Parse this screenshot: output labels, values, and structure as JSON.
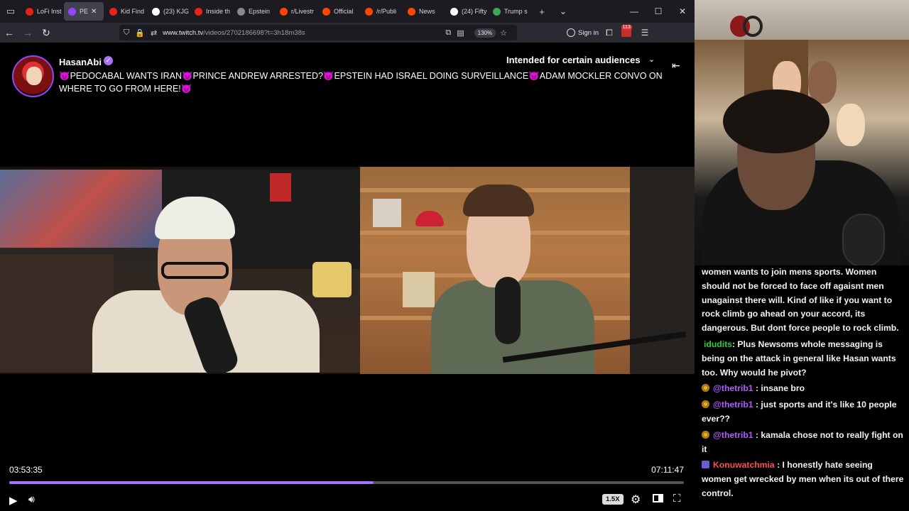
{
  "browser": {
    "tabs": [
      {
        "label": "LoFi Inst",
        "color": "#e62117",
        "active": false
      },
      {
        "label": "PE",
        "color": "#9147ff",
        "active": true
      },
      {
        "label": "Kid Find",
        "color": "#e62117",
        "active": false
      },
      {
        "label": "(23) KJG",
        "color": "#ffffff",
        "active": false
      },
      {
        "label": "Inside th",
        "color": "#e62117",
        "active": false
      },
      {
        "label": "Epstein",
        "color": "#888888",
        "active": false
      },
      {
        "label": "r/Livestr",
        "color": "#ff4500",
        "active": false
      },
      {
        "label": "Official",
        "color": "#ff4500",
        "active": false
      },
      {
        "label": "/r/Publi",
        "color": "#ff4500",
        "active": false
      },
      {
        "label": "News",
        "color": "#ff4500",
        "active": false
      },
      {
        "label": "(24) Fifty",
        "color": "#ffffff",
        "active": false
      },
      {
        "label": "Trump s",
        "color": "#3aa757",
        "active": false
      }
    ],
    "url_host": "www.twitch.tv",
    "url_path": "/videos/2702186698?t=3h18m38s",
    "zoom": "130%",
    "sign_in": "Sign in",
    "notification_count": "113"
  },
  "stream": {
    "channel": "HasanAbi",
    "title": "😈PEDOCABAL WANTS IRAN😈PRINCE ANDREW ARRESTED?😈EPSTEIN HAD ISRAEL DOING SURVEILLANCE😈ADAM MOCKLER CONVO ON WHERE TO GO FROM HERE!😈",
    "audience": "Intended for certain audiences"
  },
  "player": {
    "current_time": "03:53:35",
    "total_time": "07:11:47",
    "progress": 0.5405,
    "speed": "1.5X"
  },
  "chat": [
    {
      "user": "",
      "user_color": "#ffffff",
      "badge": "",
      "text": "women wants to join mens sports. Women should not be forced to face off agaisnt men unagainst there will. Kind of like if you want to rock climb go ahead on your accord, its dangerous. But dont force people to rock climb."
    },
    {
      "user": "idudits",
      "user_color": "#2ecc40",
      "badge": "",
      "text": ": Plus Newsoms whole messaging is being on the attack in general like Hasan wants too. Why would he pivot?"
    },
    {
      "user": "@thetrib1",
      "user_color": "#b05cff",
      "badge": "gold",
      "text": " : insane bro"
    },
    {
      "user": "@thetrib1",
      "user_color": "#b05cff",
      "badge": "gold",
      "text": " : just sports and it's like 10 people ever??"
    },
    {
      "user": "@thetrib1",
      "user_color": "#b05cff",
      "badge": "gold",
      "text": " : kamala chose not to really fight on it"
    },
    {
      "user": "Konuwatchmia",
      "user_color": "#ff4d4d",
      "badge": "sub",
      "text": " : I honestly hate seeing women get wrecked by men when its out of there control."
    }
  ]
}
